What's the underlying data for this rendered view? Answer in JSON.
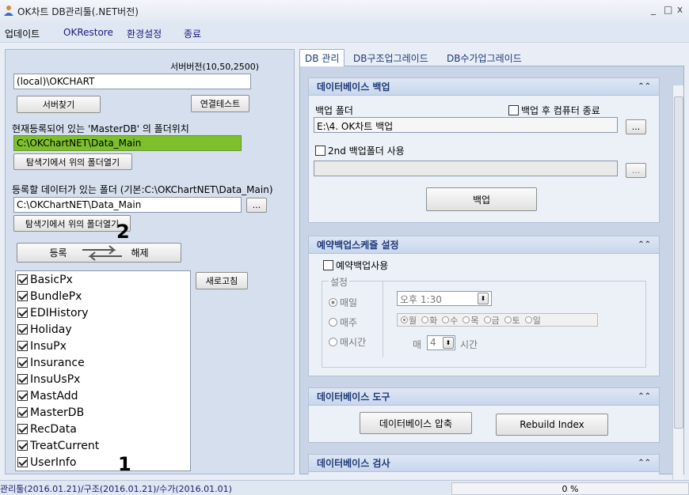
{
  "window": {
    "title": "OK차트 DB관리툴(.NET버전)",
    "min": "_",
    "max": "□",
    "close": "x"
  },
  "menu": [
    "업데이트",
    "OKRestore",
    "환경설정",
    "종료"
  ],
  "left": {
    "server_version": "서버버전(10,50,2500)",
    "server_input": "(local)\\OKCHART",
    "find_server": "서버찾기",
    "conn_test": "연결테스트",
    "master_label": "현재등록되어 있는 'MasterDB' 의 폴더위치",
    "master_path": "C:\\OKChartNET\\Data_Main",
    "open_folder1": "탐색기에서 위의 폴더열기",
    "data_label": "등록할 데이터가 있는 폴더 (기본:C:\\OKChartNET\\Data_Main)",
    "data_path": "C:\\OKChartNET\\Data_Main",
    "browse": "...",
    "open_folder2": "탐색기에서 위의 폴더열기",
    "register": "등록",
    "unregister": "해제",
    "refresh": "새로고침",
    "marker_top": "2",
    "marker_bottom": "1",
    "databases": [
      "BasicPx",
      "BundlePx",
      "EDIHistory",
      "Holiday",
      "InsuPx",
      "Insurance",
      "InsuUsPx",
      "MastAdd",
      "MasterDB",
      "RecData",
      "TreatCurrent",
      "UserInfo"
    ]
  },
  "tabs": [
    "DB 관리",
    "DB구조업그레이드",
    "DB수가업그레이드"
  ],
  "backup": {
    "header": "데이터베이스 백업",
    "folder_label": "백업 폴더",
    "shutdown_label": "백업 후 컴퓨터 종료",
    "folder_value": "E:\\4. OK차트 백업",
    "browse": "...",
    "second_label": "2nd 백업폴더 사용",
    "browse2": "...",
    "backup_btn": "백업"
  },
  "schedule": {
    "header": "예약백업스케쥴 설정",
    "use_label": "예약백업사용",
    "group": "설정",
    "daily": "매일",
    "weekly": "매주",
    "hourly": "매시간",
    "time": "오후  1:30",
    "days": [
      "월",
      "화",
      "수",
      "목",
      "금",
      "토",
      "일"
    ],
    "every": "매",
    "hours": "4",
    "hour_unit": "시간"
  },
  "tools": {
    "header": "데이터베이스 도구",
    "compress": "데이터베이스 압축",
    "rebuild": "Rebuild Index"
  },
  "check": {
    "header": "데이터베이스 검사"
  },
  "status": {
    "text": "관리툴(2016.01.21)/구조(2016.01.21)/수가(2016.01.01)",
    "progress": "0 %"
  }
}
